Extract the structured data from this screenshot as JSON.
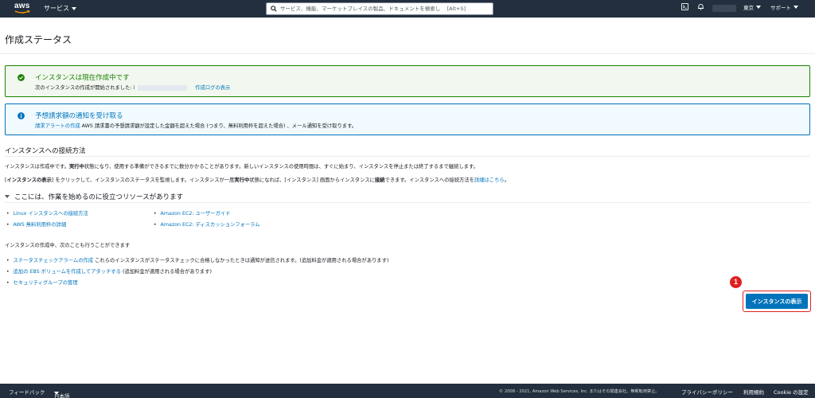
{
  "nav": {
    "logo_text": "aws",
    "services_label": "サービス",
    "search_placeholder": "サービス、機能、マーケットプレイスの製品、ドキュメントを検索し    [Alt+S]",
    "region_label": "東京",
    "support_label": "サポート"
  },
  "page": {
    "title": "作成ステータス"
  },
  "success_alert": {
    "title": "インスタンスは現在作成中です",
    "body_prefix": "次のインスタンスの作成が開始されました: i",
    "log_link": "作成ログの表示"
  },
  "info_alert": {
    "title": "予想請求額の通知を受け取る",
    "link": "請求アラートの作成",
    "body": " AWS 請求書の予想請求額が設定した金額を超えた場合 (つまり、無料利用枠を超えた場合) 、メール通知を受け取ります。"
  },
  "connect": {
    "heading": "インスタンスへの接続方法",
    "p1_a": "インスタンスは作成中です。",
    "p1_b": "実行中",
    "p1_c": "状態になり、使用する準備ができるまでに数分かかることがあります。新しいインスタンスの使用時間は、すぐに始まり、インスタンスを停止または終了するまで継続します。",
    "p2_a": "[",
    "p2_b": "インスタンスの表示",
    "p2_c": "] をクリックして、インスタンスのステータスを監視します。インスタンスが一度",
    "p2_d": "実行中",
    "p2_e": "状態になれば、[インスタンス] 画面からインスタンスに",
    "p2_f": "接続",
    "p2_g": "できます。インスタンスへの接続方法を",
    "p2_link": "詳細はこちら",
    "p2_end": "。"
  },
  "resources": {
    "heading": "ここには、作業を始めるのに役立つリソースがあります",
    "left_links": [
      "Linux インスタンスへの接続方法",
      "AWS 無料利用枠の詳細"
    ],
    "right_links": [
      "Amazon EC2: ユーザーガイド",
      "Amazon EC2: ディスカッションフォーラム"
    ]
  },
  "also": {
    "heading": "インスタンスの作成中、次のことも行うことができます",
    "items": [
      {
        "link": "ステータスチェックアラームの作成",
        "text": " これらのインスタンスがステータスチェックに合格しなかったときは通知が送信されます。(追加料金が適用される場合があります)"
      },
      {
        "link": "追加の EBS ボリュームを作成してアタッチする",
        "text": " (追加料金が適用される場合があります)"
      },
      {
        "link": "セキュリティグループの管理",
        "text": ""
      }
    ]
  },
  "actions": {
    "step_number": "1",
    "view_instances": "インスタンスの表示"
  },
  "footer": {
    "feedback": "フィードバック",
    "language": "日本語",
    "copyright": "© 2008 - 2021, Amazon Web Services, Inc. またはその関連会社。無断転用禁止。",
    "privacy": "プライバシーポリシー",
    "terms": "利用規約",
    "cookie": "Cookie の設定"
  },
  "colors": {
    "nav_bg": "#232f3e",
    "success": "#1d8102",
    "info": "#0073bb",
    "primary": "#0073bb",
    "highlight": "#e02020"
  }
}
